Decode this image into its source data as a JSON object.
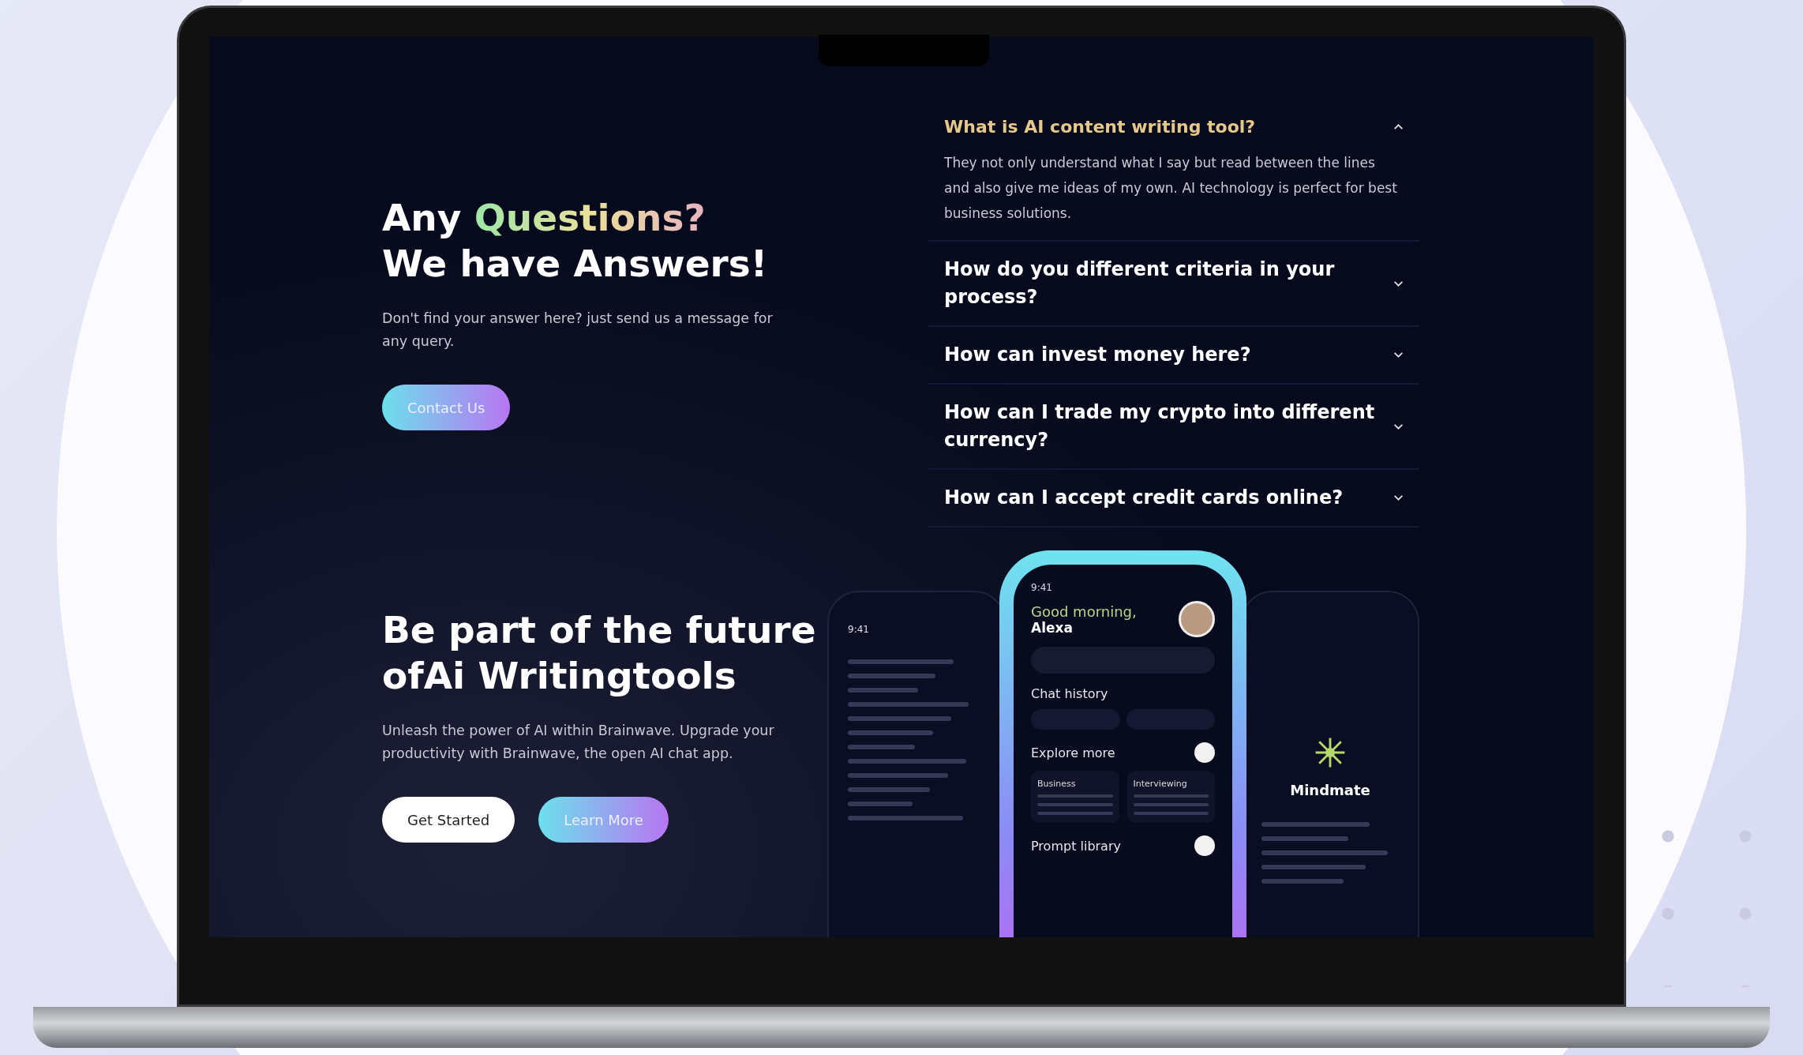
{
  "faq_intro": {
    "lead": "Any",
    "highlight": "Questions?",
    "line2": "We have Answers!",
    "text": "Don't find your answer here? just send us a message for any query.",
    "button": "Contact Us"
  },
  "faq": [
    {
      "question": "What is AI content writing tool?",
      "answer": "They not only understand what I say but read between the lines and also give me ideas of my own. AI technology is perfect for best business solutions.",
      "expanded": true
    },
    {
      "question": "How do you different criteria in your process?",
      "expanded": false
    },
    {
      "question": "How can invest money here?",
      "expanded": false
    },
    {
      "question": "How can I trade my crypto into different currency?",
      "expanded": false
    },
    {
      "question": "How can I accept credit cards online?",
      "expanded": false
    }
  ],
  "cta": {
    "title_lines": [
      "Be part of the future",
      "ofAi Writingtools"
    ],
    "text": "Unleash the power of AI within Brainwave. Upgrade your productivity with Brainwave, the open AI chat app.",
    "buttons": [
      {
        "label": "Get Started",
        "kind": "solid"
      },
      {
        "label": "Learn More",
        "kind": "gradient"
      }
    ]
  },
  "phones": {
    "left": {
      "time": "9:41"
    },
    "center": {
      "time": "9:41",
      "greeting": "Good morning,",
      "name": "Alexa",
      "sections": [
        "Chat history",
        "Explore more",
        "Prompt library"
      ],
      "cards": [
        "Business",
        "Interviewing"
      ]
    },
    "right": {
      "title": "Mindmate"
    }
  }
}
